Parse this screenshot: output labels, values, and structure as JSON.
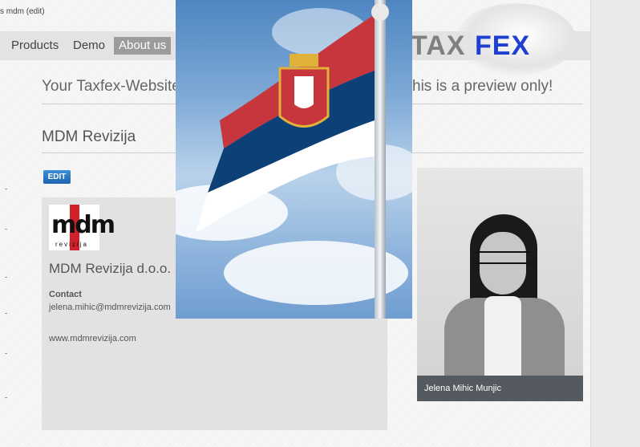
{
  "header": {
    "top_link": "s mdm (edit)",
    "logo": {
      "left": "TAX",
      "right": "FEX"
    }
  },
  "nav": {
    "items": [
      {
        "label": "Products"
      },
      {
        "label": "Demo"
      },
      {
        "label": "About us",
        "active": true
      }
    ]
  },
  "main": {
    "preview_notice_left": "Your Taxfex-Website",
    "preview_notice_right": "his is a preview only!",
    "section_title": "MDM Revizija",
    "edit_button": "EDIT"
  },
  "company": {
    "logo_text": "mdm",
    "logo_subtext": "revizija",
    "name": "MDM Revizija d.o.o.",
    "contact_label": "Contact",
    "email": "jelena.mihic@mdmrevizija.com",
    "website": "www.mdmrevizija.com"
  },
  "person": {
    "caption": "Jelena Mihic Munjic"
  },
  "colors": {
    "brand_blue": "#1e3fd1",
    "edit_button": "#1d64b0",
    "flag_red": "#c6363c",
    "flag_blue": "#0c4076"
  }
}
